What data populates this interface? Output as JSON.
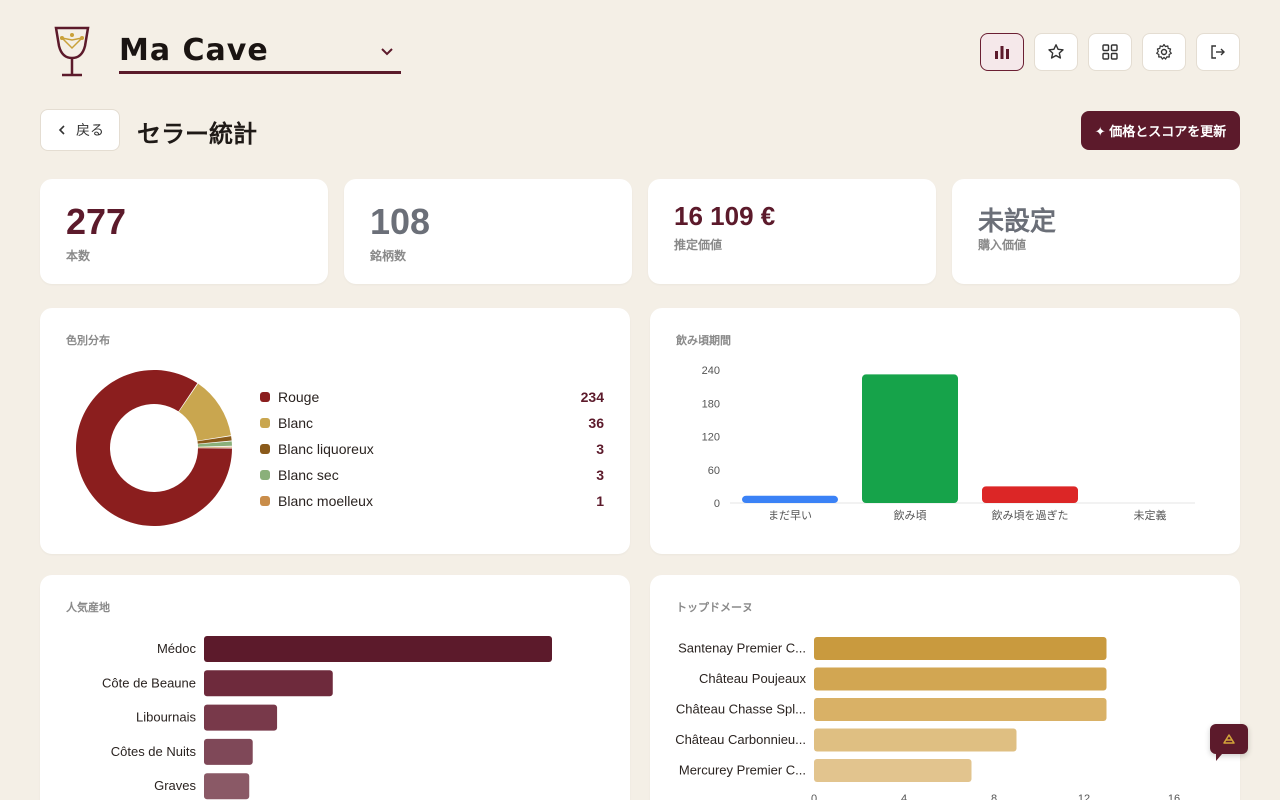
{
  "header": {
    "cellar_name": "Ma Cave",
    "icons": [
      "stats-icon",
      "star-icon",
      "grid-icon",
      "gear-icon",
      "logout-icon"
    ]
  },
  "toolbar": {
    "back_label": "戻る",
    "page_title": "セラー統計",
    "update_label": "✦ 価格とスコアを更新"
  },
  "stats": [
    {
      "value": "277",
      "label": "本数",
      "color": "#5c1a2b"
    },
    {
      "value": "108",
      "label": "銘柄数",
      "color": "#6b6f78"
    },
    {
      "value": "16 109 €",
      "label": "推定価値",
      "color": "#5c1a2b"
    },
    {
      "value": "未設定",
      "label": "購入価値",
      "color": "#6b6f78"
    }
  ],
  "color_panel": {
    "title": "色別分布",
    "chart_data": {
      "type": "pie",
      "categories": [
        "Rouge",
        "Blanc",
        "Blanc liquoreux",
        "Blanc sec",
        "Blanc moelleux"
      ],
      "values": [
        234,
        36,
        3,
        3,
        1
      ],
      "colors": [
        "#8b1e1e",
        "#c9a64f",
        "#8a5a1a",
        "#8ab07a",
        "#c98d4a"
      ]
    }
  },
  "drinking_panel": {
    "title": "飲み頃期間",
    "chart_data": {
      "type": "bar",
      "categories": [
        "まだ早い",
        "飲み頃",
        "飲み頃を過ぎた",
        "未定義"
      ],
      "values": [
        13,
        232,
        30,
        0
      ],
      "colors": [
        "#3b82f6",
        "#16a34a",
        "#dc2626",
        "#9ca3af"
      ],
      "ylim": [
        0,
        240
      ],
      "yticks": [
        0,
        60,
        120,
        180,
        240
      ]
    }
  },
  "region_panel": {
    "title": "人気産地",
    "chart_data": {
      "type": "bar",
      "categories": [
        "Médoc",
        "Côte de Beaune",
        "Libournais",
        "Côtes de Nuits",
        "Graves"
      ],
      "values": [
        100,
        37,
        21,
        14,
        13
      ],
      "colors": [
        "#5c1a2b",
        "#6e2a3c",
        "#78394a",
        "#7f4858",
        "#8a5966"
      ]
    }
  },
  "domain_panel": {
    "title": "トップドメーヌ",
    "chart_data": {
      "type": "bar",
      "categories": [
        "Santenay Premier C...",
        "Château Poujeaux",
        "Château Chasse Spl...",
        "Château Carbonnieu...",
        "Mercurey Premier C..."
      ],
      "values": [
        13,
        13,
        13,
        9,
        7
      ],
      "colors": [
        "#c99a3e",
        "#d2a652",
        "#d9b166",
        "#dfbf82",
        "#e2c48e"
      ],
      "xticks": [
        0,
        4,
        8,
        12,
        16
      ],
      "xlim": [
        0,
        16
      ]
    }
  }
}
